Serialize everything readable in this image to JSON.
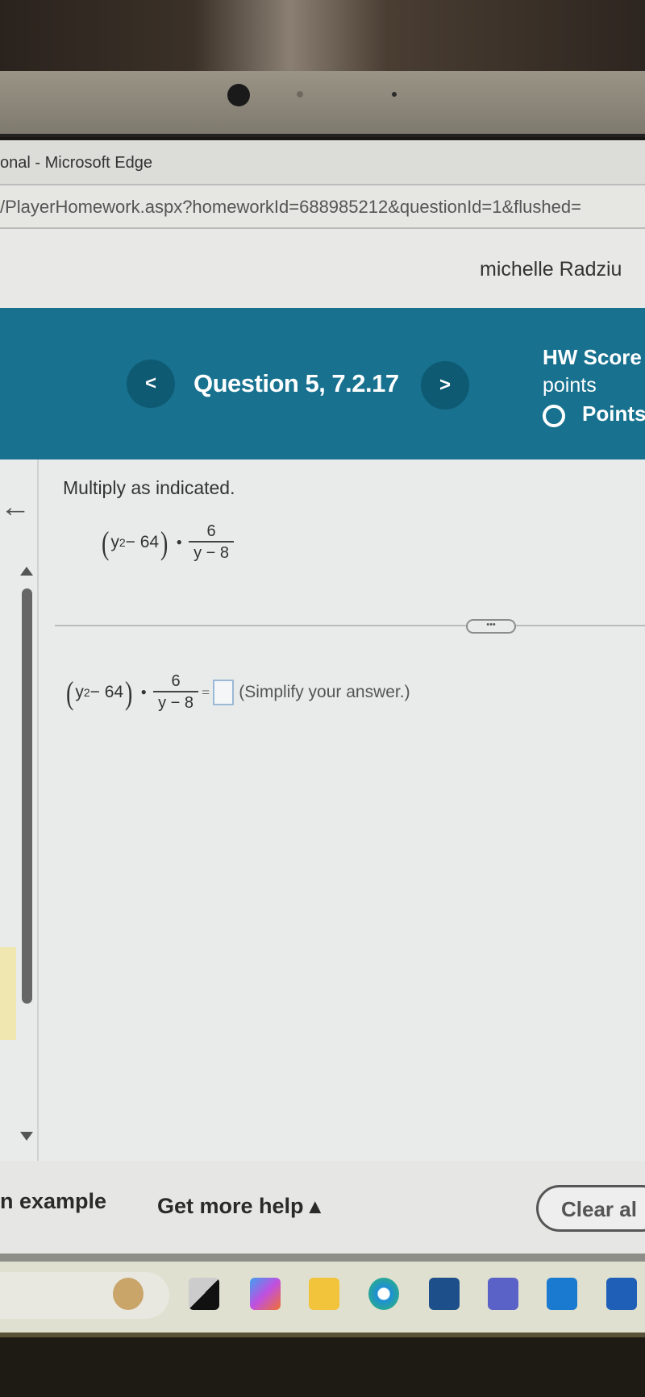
{
  "browser": {
    "window_title": "onal - Microsoft Edge",
    "url": "/PlayerHomework.aspx?homeworkId=688985212&questionId=1&flushed="
  },
  "header": {
    "user_name": "michelle Radziu"
  },
  "question_nav": {
    "prev_label": "<",
    "title": "Question 5, 7.2.17",
    "next_label": ">",
    "hw_score_label": "HW Score",
    "points_label": "points",
    "points_status": "Points"
  },
  "question": {
    "instruction": "Multiply as indicated.",
    "expression": {
      "open": "(",
      "base": "y",
      "exponent": "2",
      "minus_term": " − 64",
      "close": ")",
      "dot": "•",
      "numerator": "6",
      "denominator": "y − 8"
    },
    "more_label": "•••",
    "equals": "=",
    "answer_value": "",
    "hint": "(Simplify your answer.)"
  },
  "footer": {
    "example_label": "n example",
    "more_help_label": "Get more help ▴",
    "clear_all_label": "Clear al"
  },
  "taskbar": {
    "icons": [
      "widgets-icon",
      "task-view-icon",
      "copilot-icon",
      "file-explorer-icon",
      "edge-icon",
      "store-icon",
      "teams-icon",
      "outlook-icon",
      "word-icon"
    ]
  },
  "colors": {
    "accent": "#17718f",
    "nav_button": "#0f5a73"
  }
}
